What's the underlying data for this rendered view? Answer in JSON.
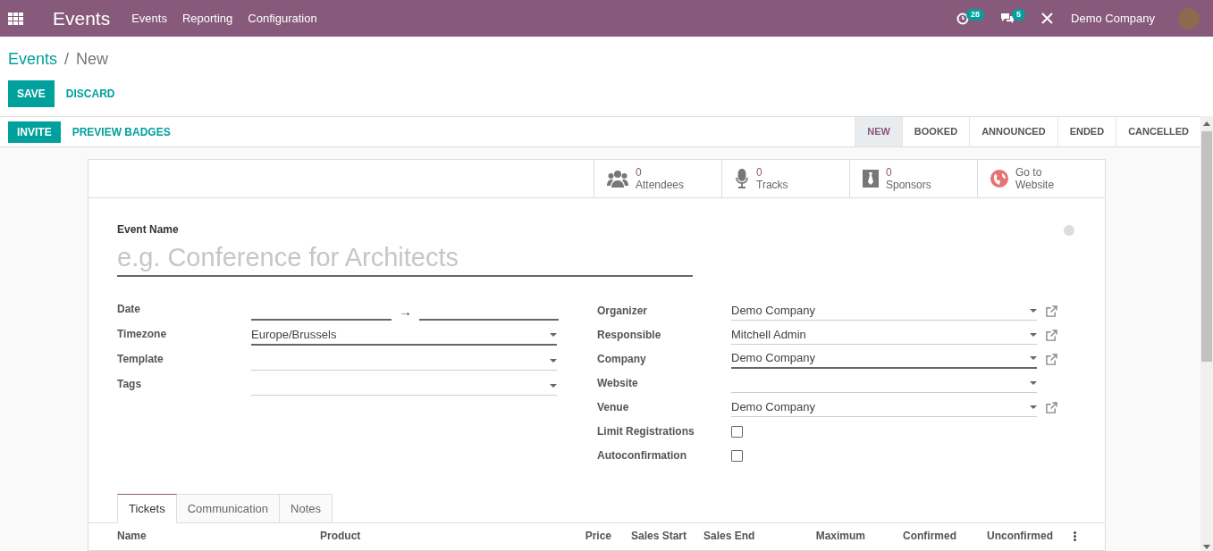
{
  "navbar": {
    "app_title": "Events",
    "menu": [
      "Events",
      "Reporting",
      "Configuration"
    ],
    "activity_badge": "28",
    "messages_badge": "5",
    "company": "Demo Company"
  },
  "breadcrumb": {
    "parent": "Events",
    "separator": "/",
    "current": "New"
  },
  "actions": {
    "save": "SAVE",
    "discard": "DISCARD"
  },
  "header_buttons": [
    {
      "label": "INVITE",
      "kind": "primary"
    },
    {
      "label": "PREVIEW BADGES",
      "kind": "link"
    }
  ],
  "stages": [
    {
      "label": "NEW",
      "selected": true
    },
    {
      "label": "BOOKED",
      "selected": false
    },
    {
      "label": "ANNOUNCED",
      "selected": false
    },
    {
      "label": "ENDED",
      "selected": false
    },
    {
      "label": "CANCELLED",
      "selected": false
    }
  ],
  "smart_buttons": [
    {
      "kind": "attendees",
      "count": "0",
      "label": "Attendees"
    },
    {
      "kind": "tracks",
      "count": "0",
      "label": "Tracks"
    },
    {
      "kind": "sponsors",
      "count": "0",
      "label": "Sponsors"
    },
    {
      "kind": "website",
      "label": "Go to Website"
    }
  ],
  "event_name": {
    "label": "Event Name",
    "placeholder": "e.g. Conference for Architects"
  },
  "left_fields": [
    {
      "label": "Date",
      "kind": "daterange",
      "separator": "→",
      "required": true
    },
    {
      "label": "Timezone",
      "kind": "select",
      "value": "Europe/Brussels",
      "required": true
    },
    {
      "label": "Template",
      "kind": "select",
      "required": false
    },
    {
      "label": "Tags",
      "kind": "select",
      "required": false
    }
  ],
  "right_fields": [
    {
      "label": "Organizer",
      "kind": "select",
      "value": "Demo Company",
      "required": false,
      "external_link": true
    },
    {
      "label": "Responsible",
      "kind": "select",
      "value": "Mitchell Admin",
      "required": false,
      "external_link": true
    },
    {
      "label": "Company",
      "kind": "select",
      "value": "Demo Company",
      "required": true,
      "external_link": true
    },
    {
      "label": "Website",
      "kind": "select",
      "required": false,
      "external_link": false
    },
    {
      "label": "Venue",
      "kind": "select",
      "value": "Demo Company",
      "required": false,
      "external_link": true
    },
    {
      "label": "Limit Registrations",
      "kind": "checkbox",
      "checked": false
    },
    {
      "label": "Autoconfirmation",
      "kind": "checkbox",
      "checked": false
    }
  ],
  "tabs": [
    {
      "label": "Tickets",
      "selected": true
    },
    {
      "label": "Communication",
      "selected": false
    },
    {
      "label": "Notes",
      "selected": false
    }
  ],
  "table": {
    "columns": [
      "Name",
      "Product",
      "Price",
      "Sales Start",
      "Sales End",
      "Maximum",
      "Confirmed",
      "Unconfirmed"
    ]
  }
}
